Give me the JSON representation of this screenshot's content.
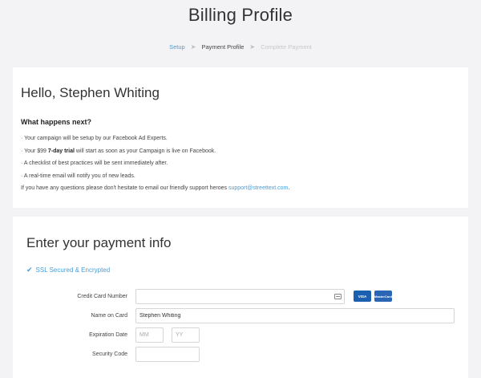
{
  "page_title": "Billing Profile",
  "steps": [
    {
      "label": "Setup",
      "state": "done"
    },
    {
      "label": "Payment Profile",
      "state": "current"
    },
    {
      "label": "Complete Payment",
      "state": "upcoming"
    }
  ],
  "step_separator": "➤",
  "hello": {
    "title": "Hello, Stephen Whiting",
    "subtitle": "What happens next?",
    "line1": "· Your campaign will be setup by our Facebook Ad Experts.",
    "line2_pre": "· Your $99 ",
    "line2_bold": "7-day trial",
    "line2_post": " will start as soon as your Campaign is live on Facebook.",
    "line3": "· A checklist of best practices will be sent immediately after.",
    "line4": "· A real-time email will notify you of new leads.",
    "line5_pre": "If you have any questions please don't hesitate to email our friendly support heroes ",
    "support_email": "support@streettext.com",
    "line5_post": "."
  },
  "payment": {
    "title": "Enter your payment info",
    "ssl_label": "SSL Secured & Encrypted",
    "card_number_label": "Credit Card Number",
    "card_number_value": "",
    "name_label": "Name on Card",
    "name_value": "Stephen Whiting",
    "expiration_label": "Expiration Date",
    "month_placeholder": "MM",
    "year_placeholder": "YY",
    "security_label": "Security Code",
    "security_value": "",
    "visa_logo": "VISA",
    "mastercard_logo": "MasterCard"
  },
  "colors": {
    "accent": "#4a9ed8",
    "background": "#f3f3f5",
    "card": "#ffffff"
  }
}
